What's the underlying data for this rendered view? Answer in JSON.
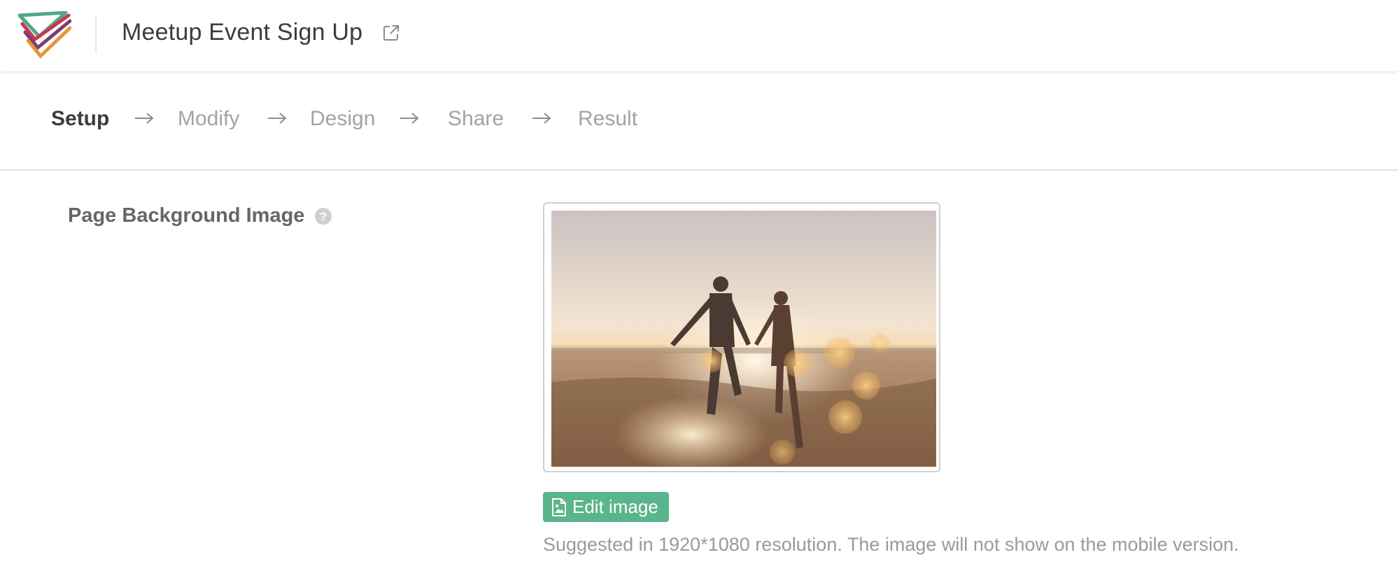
{
  "header": {
    "title": "Meetup Event Sign Up",
    "logo_icon": "checkmark-stack-logo",
    "link_icon": "external-link-icon"
  },
  "steps": [
    {
      "label": "Setup",
      "active": true
    },
    {
      "label": "Modify",
      "active": false
    },
    {
      "label": "Design",
      "active": false
    },
    {
      "label": "Share",
      "active": false
    },
    {
      "label": "Result",
      "active": false
    }
  ],
  "field": {
    "label": "Page Background Image",
    "help_icon": "question-circle-icon"
  },
  "image": {
    "description_icon": "beach-couple-photo"
  },
  "edit_button": {
    "label": "Edit image",
    "icon": "image-file-icon"
  },
  "hint": "Suggested in 1920*1080 resolution. The image will not show on the mobile version.",
  "colors": {
    "accent": "#5ab58c",
    "active_step": "#3c3c3c",
    "inactive_step": "#a3a3a3"
  }
}
